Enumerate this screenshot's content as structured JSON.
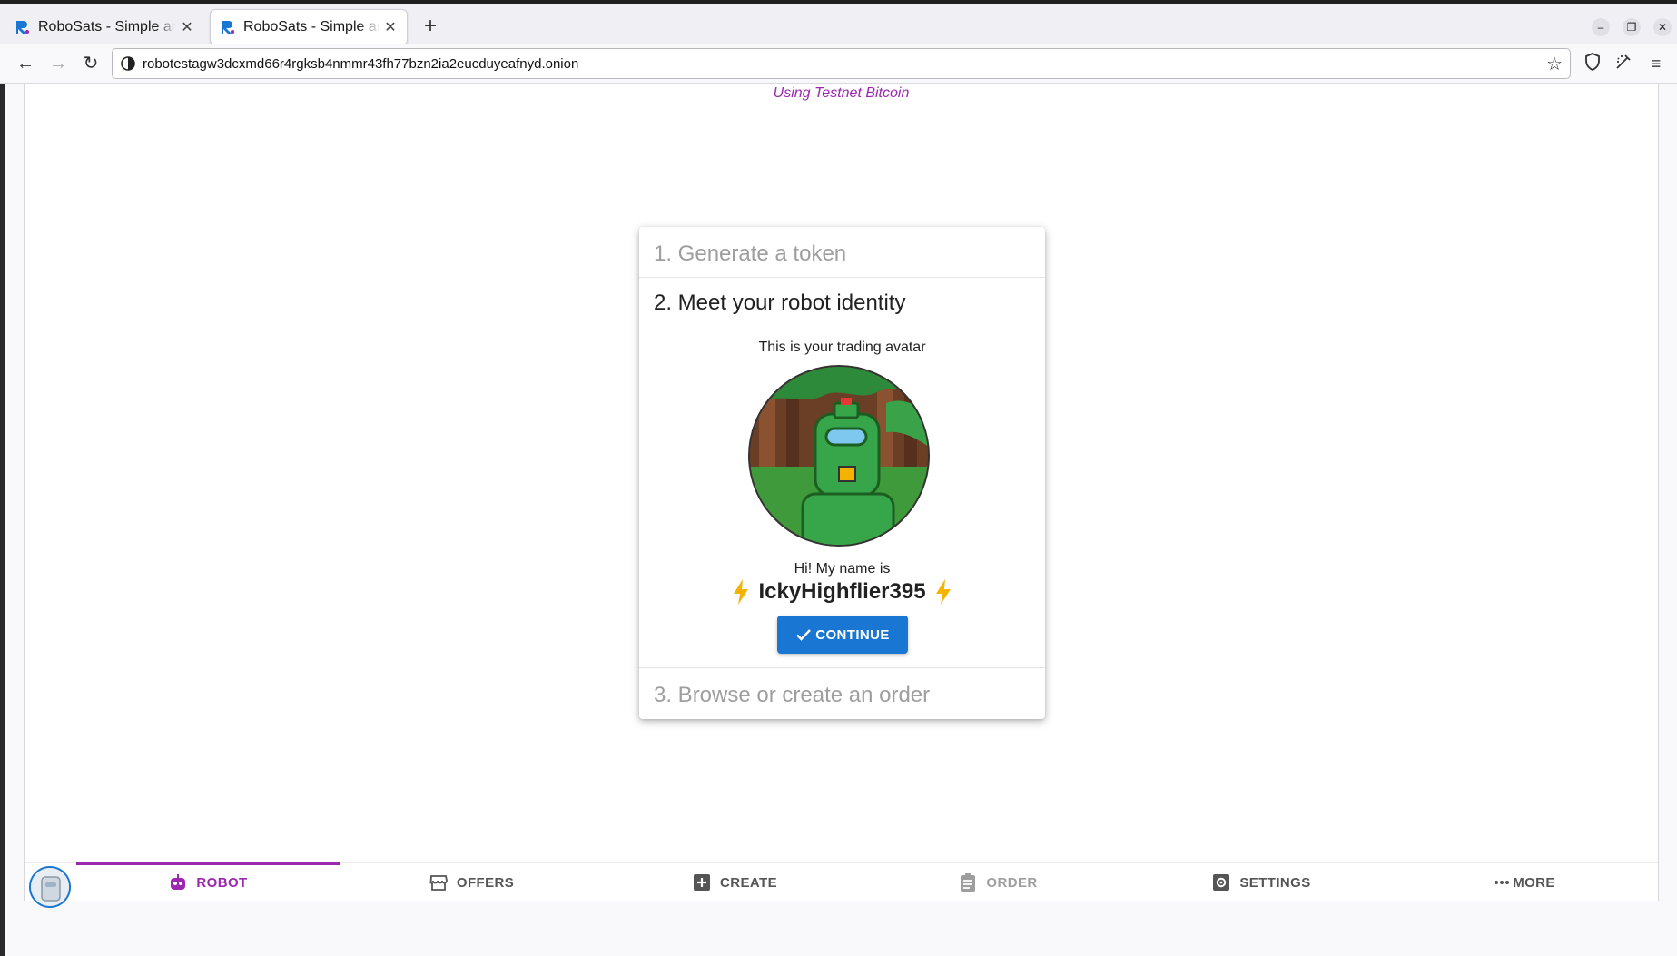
{
  "browser": {
    "tabs": [
      {
        "title": "RoboSats - Simple and Private Bitcoin Exchange",
        "active": false
      },
      {
        "title": "RoboSats - Simple and Private Bitcoin Exchange",
        "active": true
      }
    ],
    "url": "robotestagw3dcxmd66r4rgksb4nmmr43fh77bzn2ia2eucduyeafnyd.onion"
  },
  "page": {
    "network_notice": "Using Testnet Bitcoin",
    "steps": [
      {
        "label": "1. Generate a token"
      },
      {
        "label": "2. Meet your robot identity"
      },
      {
        "label": "3. Browse or create an order"
      }
    ],
    "avatar_caption": "This is your trading avatar",
    "greeting": "Hi! My name is",
    "robot_name": "IckyHighflier395",
    "continue_label": "CONTINUE"
  },
  "bottom_nav": {
    "items": [
      {
        "label": "ROBOT",
        "icon": "robot-icon",
        "state": "active"
      },
      {
        "label": "OFFERS",
        "icon": "storefront-icon",
        "state": "normal"
      },
      {
        "label": "CREATE",
        "icon": "add-box-icon",
        "state": "normal"
      },
      {
        "label": "ORDER",
        "icon": "assignment-icon",
        "state": "disabled"
      },
      {
        "label": "SETTINGS",
        "icon": "settings-applications-icon",
        "state": "normal"
      },
      {
        "label": "MORE",
        "icon": "more-horiz-icon",
        "state": "normal"
      }
    ]
  },
  "colors": {
    "accent_purple": "#9c27b0",
    "primary_blue": "#1976d2",
    "bolt_amber": "#f5b301"
  }
}
